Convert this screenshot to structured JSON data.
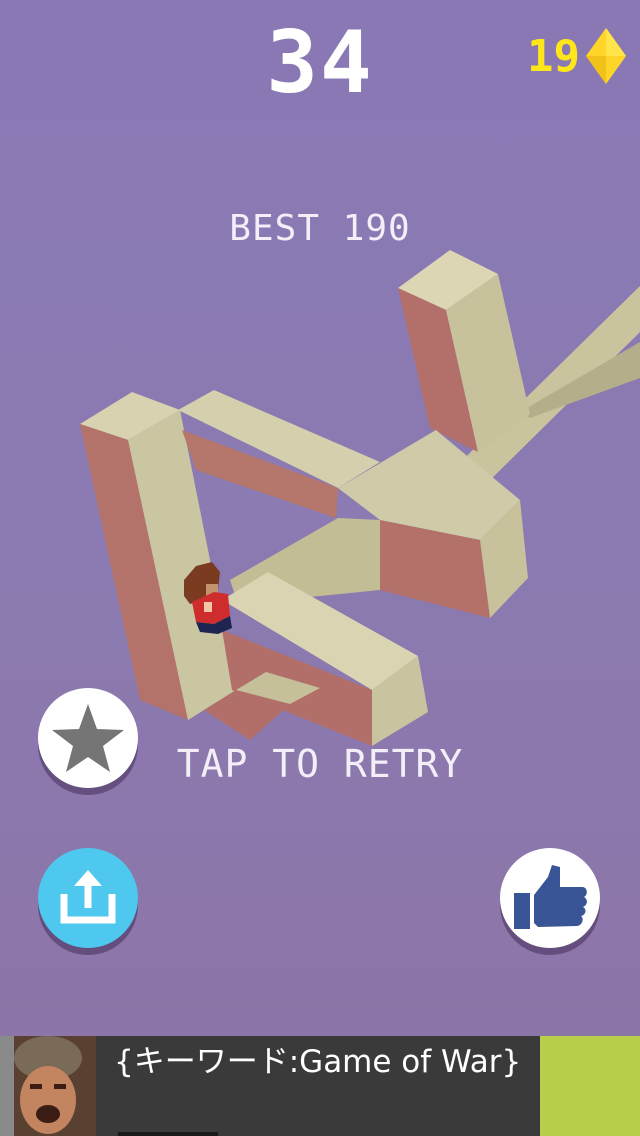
{
  "hud": {
    "score": "34",
    "gem_count": "19",
    "gem_icon": "diamond-icon",
    "gem_color": "#ffd52a"
  },
  "game_over": {
    "best_text": "BEST 190",
    "retry_text": "TAP TO RETRY"
  },
  "buttons": {
    "rate_icon": "star-icon",
    "share_icon": "share-icon",
    "like_icon": "thumbs-up-icon",
    "share_color": "#4ec8ee"
  },
  "ad": {
    "text": "{キーワード:Game of War}"
  },
  "colors": {
    "background": "#8a78b4",
    "wall_top": "#d3ceac",
    "wall_side": "#b5756c",
    "wall_front": "#c8c49e"
  }
}
